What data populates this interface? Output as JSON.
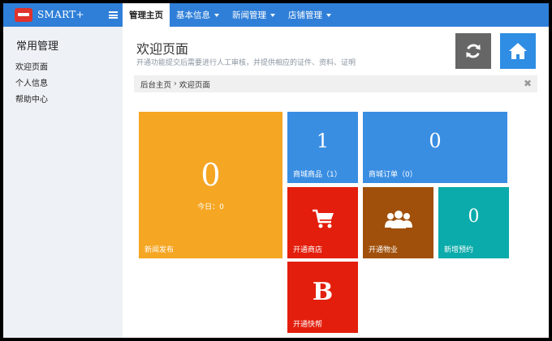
{
  "brand": {
    "name": "SMART+"
  },
  "nav": {
    "items": [
      {
        "label": "管理主页"
      },
      {
        "label": "基本信息"
      },
      {
        "label": "新闻管理"
      },
      {
        "label": "店铺管理"
      }
    ]
  },
  "sidebar": {
    "title": "常用管理",
    "items": [
      {
        "label": "欢迎页面"
      },
      {
        "label": "个人信息"
      },
      {
        "label": "帮助中心"
      }
    ]
  },
  "header": {
    "title": "欢迎页面",
    "subtitle": "开通功能提交后需要进行人工审核，并提供相应的证件、资料、证明"
  },
  "breadcrumb": {
    "home": "后台主页",
    "separator": "›",
    "current": "欢迎页面"
  },
  "tiles": {
    "news": {
      "value": "0",
      "today": "今日：0",
      "label": "新闻发布",
      "color": "#f5a623"
    },
    "goods": {
      "value": "1",
      "label": "商城商品（1）",
      "color": "#3a8ee2"
    },
    "orders": {
      "value": "0",
      "label": "商城订单（0）",
      "color": "#3a8ee2"
    },
    "shop": {
      "label": "开通商店",
      "icon": "shopping-cart-icon",
      "color": "#e31e0c"
    },
    "property": {
      "label": "开通物业",
      "icon": "users-icon",
      "color": "#a0500a"
    },
    "booking": {
      "value": "0",
      "label": "新增预约",
      "color": "#0aabaa"
    },
    "help": {
      "glyph": "B",
      "label": "开通快帮",
      "color": "#e31e0c"
    }
  }
}
